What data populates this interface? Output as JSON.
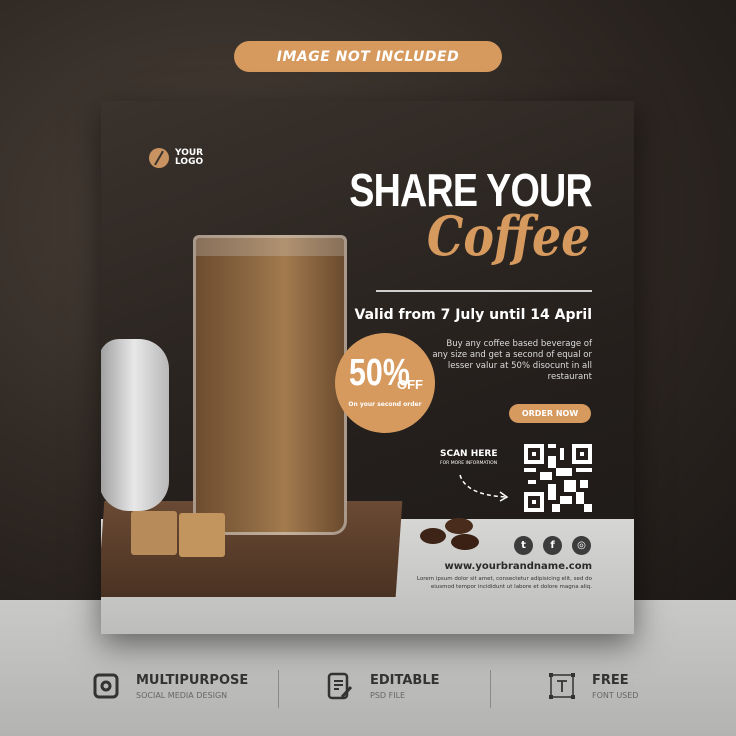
{
  "badge": "IMAGE NOT INCLUDED",
  "logo": {
    "line1": "YOUR",
    "line2": "LOGO"
  },
  "title": {
    "line1": "SHARE YOUR",
    "line2": "Coffee"
  },
  "valid": "Valid from 7 July until 14 April",
  "description": "Buy any coffee based beverage of any size and get a second of equal or lesser valur at 50% disocunt in all restaurant",
  "discount": {
    "percent": "50%",
    "off": "OFF",
    "sub": "On your second order"
  },
  "order_button": "ORDER NOW",
  "scan": {
    "title": "SCAN HERE",
    "sub": "FOR MORE INFORMATION"
  },
  "social": [
    "twitter-icon",
    "facebook-icon",
    "instagram-icon"
  ],
  "url": "www.yourbrandname.com",
  "lorem": "Lorem ipsum dolor sit amet, consectetur adipisicing elit, sed do eiusmod tempor incididunt ut labore et dolore magna aliq.",
  "features": [
    {
      "title": "MULTIPURPOSE",
      "sub": "SOCIAL MEDIA DESIGN"
    },
    {
      "title": "EDITABLE",
      "sub": "PSD FILE"
    },
    {
      "title": "FREE",
      "sub": "FONT USED"
    }
  ],
  "colors": {
    "accent": "#d69a5f",
    "dark": "#241f1c"
  }
}
